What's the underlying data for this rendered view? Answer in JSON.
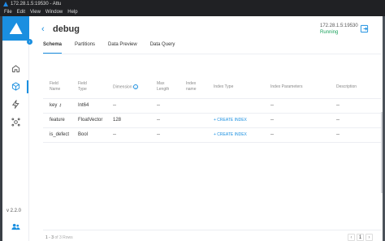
{
  "titlebar": {
    "title": "172.28.1.5:19530 - Attu"
  },
  "menubar": {
    "items": [
      "File",
      "Edit",
      "View",
      "Window",
      "Help"
    ]
  },
  "sidebar": {
    "version": "v 2.2.0",
    "nav": [
      "home-icon",
      "cube-icon",
      "bolt-icon",
      "system-icon"
    ]
  },
  "header": {
    "back": "‹",
    "title": "debug",
    "address": "172.28.1.5:19530",
    "status": "Running"
  },
  "tabs": [
    "Schema",
    "Partitions",
    "Data Preview",
    "Data Query"
  ],
  "table": {
    "headers": {
      "field_name": [
        "Field",
        "Name"
      ],
      "field_type": [
        "Field",
        "Type"
      ],
      "dimension": "Dimension",
      "max_length": [
        "Max",
        "Length"
      ],
      "index_name": [
        "Index",
        "name"
      ],
      "index_type": "Index Type",
      "index_params": "Index Parameters",
      "description": "Description"
    },
    "rows": [
      {
        "name": "key",
        "type": "Int64",
        "dimension": "--",
        "max_length": "--",
        "index_name": "",
        "index_type": "",
        "params": "--",
        "description": "--",
        "primary": true
      },
      {
        "name": "feature",
        "type": "FloatVector",
        "dimension": "128",
        "max_length": "--",
        "index_name": "",
        "index_type": "+ CREATE INDEX",
        "params": "--",
        "description": "--"
      },
      {
        "name": "is_defect",
        "type": "Bool",
        "dimension": "--",
        "max_length": "--",
        "index_name": "",
        "index_type": "+ CREATE INDEX",
        "params": "--",
        "description": "--"
      }
    ]
  },
  "footer": {
    "range": "1 - 3",
    "of_text": "of 3 Rows",
    "page": "1",
    "prev": "‹",
    "next": "›"
  },
  "colors": {
    "accent": "#1a8fe0",
    "running": "#1aa15b"
  }
}
